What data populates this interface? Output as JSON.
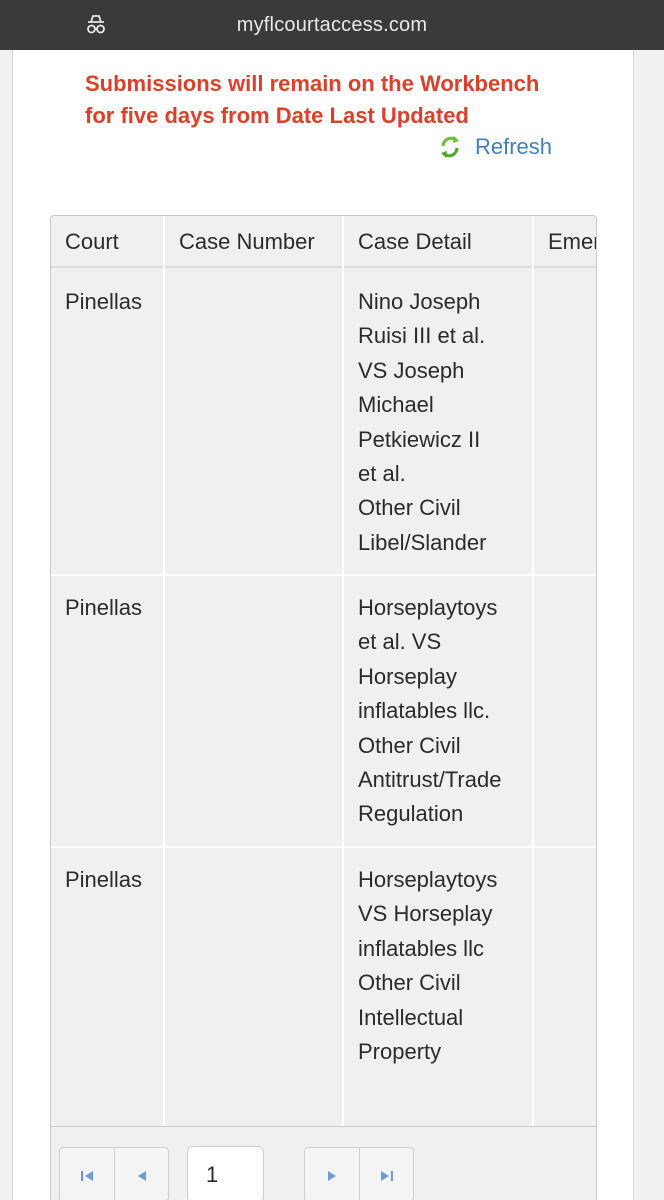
{
  "browser": {
    "url": "myflcourtaccess.com",
    "mode_icon": "incognito-icon"
  },
  "notice": {
    "line1": "Submissions will remain on the Workbench",
    "line2": "for five days from Date Last Updated",
    "color": "#d9412b"
  },
  "refresh": {
    "label": "Refresh",
    "icon": "refresh-icon"
  },
  "table": {
    "columns": [
      "Court",
      "Case Number",
      "Case Detail",
      "Emerge"
    ],
    "rows": [
      {
        "court": "Pinellas",
        "case_number": "",
        "case_detail": [
          "Nino Joseph",
          "Ruisi III et al.",
          "VS Joseph",
          "Michael",
          "Petkiewicz II",
          "et al.",
          "Other Civil",
          "Libel/Slander"
        ],
        "emergency": ""
      },
      {
        "court": "Pinellas",
        "case_number": "",
        "case_detail": [
          "Horseplaytoys",
          "et al. VS",
          "Horseplay",
          "inflatables llc.",
          "Other Civil",
          "Antitrust/Trade",
          "Regulation"
        ],
        "emergency": ""
      },
      {
        "court": "Pinellas",
        "case_number": "",
        "case_detail": [
          "Horseplaytoys",
          "VS Horseplay",
          "inflatables llc",
          "Other Civil",
          "Intellectual",
          "Property"
        ],
        "emergency": ""
      }
    ]
  },
  "pager": {
    "current_page": "1",
    "first_icon": "first-page-icon",
    "prev_icon": "prev-page-icon",
    "next_icon": "next-page-icon",
    "last_icon": "last-page-icon"
  }
}
